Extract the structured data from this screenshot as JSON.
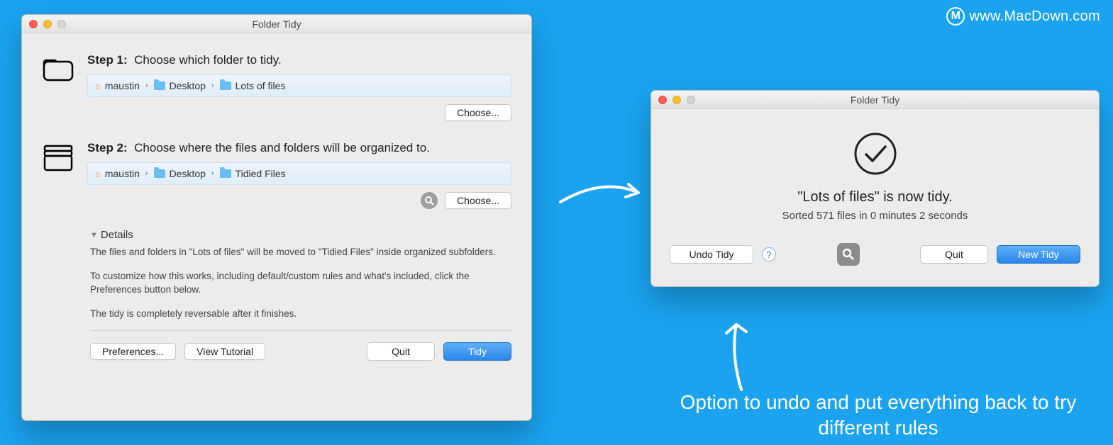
{
  "watermark": "www.MacDown.com",
  "window1": {
    "title": "Folder Tidy",
    "step1": {
      "label": "Step 1:",
      "text": "Choose which folder to tidy."
    },
    "path1": {
      "a": "maustin",
      "b": "Desktop",
      "c": "Lots of files"
    },
    "choose": "Choose...",
    "step2": {
      "label": "Step 2:",
      "text": "Choose where the files and folders will be organized to."
    },
    "path2": {
      "a": "maustin",
      "b": "Desktop",
      "c": "Tidied Files"
    },
    "details": {
      "heading": "Details",
      "p1": "The files and folders in \"Lots of files\" will be moved to \"Tidied Files\" inside organized subfolders.",
      "p2": "To customize how this works, including default/custom rules and what's included, click the Preferences button below.",
      "p3": "The tidy is completely reversable after it finishes."
    },
    "buttons": {
      "prefs": "Preferences...",
      "tutorial": "View Tutorial",
      "quit": "Quit",
      "tidy": "Tidy"
    }
  },
  "window2": {
    "title": "Folder Tidy",
    "result": "\"Lots of files\" is now tidy.",
    "sub": "Sorted 571 files in 0 minutes 2 seconds",
    "undo": "Undo Tidy",
    "quit": "Quit",
    "newtidy": "New Tidy"
  },
  "caption": "Option to undo and put everything back to try different rules"
}
